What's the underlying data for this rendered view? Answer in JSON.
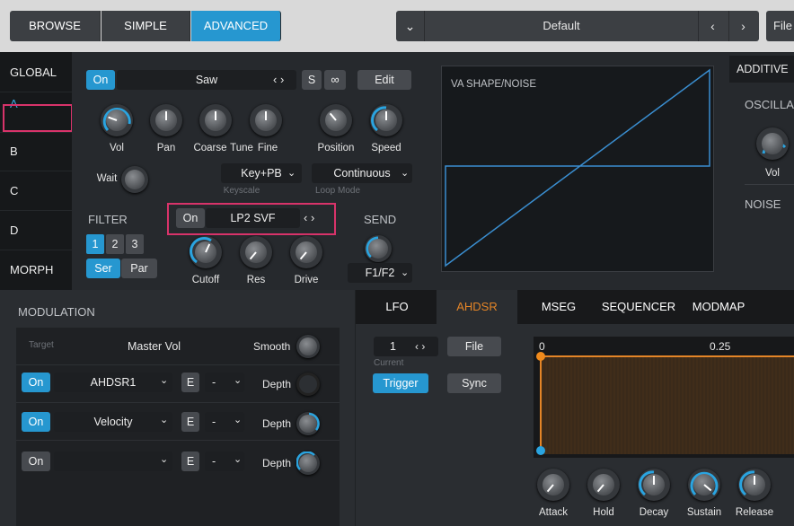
{
  "topbar": {
    "browse": "BROWSE",
    "simple": "SIMPLE",
    "advanced": "ADVANCED",
    "preset_name": "Default",
    "file": "File"
  },
  "left_tabs": [
    "GLOBAL",
    "A",
    "B",
    "C",
    "D",
    "MORPH"
  ],
  "osc": {
    "on": "On",
    "wave": "Saw",
    "s": "S",
    "edit": "Edit",
    "knobs": [
      "Vol",
      "Pan",
      "Coarse",
      "Tune",
      "Fine",
      "Position",
      "Speed"
    ],
    "wait": "Wait",
    "keyscale_value": "Key+PB",
    "keyscale_label": "Keyscale",
    "loop_value": "Continuous",
    "loop_label": "Loop Mode"
  },
  "filter": {
    "title": "FILTER",
    "on": "On",
    "type": "LP2 SVF",
    "nums": [
      "1",
      "2",
      "3"
    ],
    "ser": "Ser",
    "par": "Par",
    "knobs": [
      "Cutoff",
      "Res",
      "Drive"
    ]
  },
  "send": {
    "title": "SEND",
    "value": "F1/F2"
  },
  "graph": {
    "title": "VA SHAPE/NOISE"
  },
  "additive": {
    "tab": "ADDITIVE",
    "oscill": "OSCILLA",
    "vol": "Vol",
    "noise": "NOISE"
  },
  "modulation": {
    "title": "MODULATION",
    "target_label": "Target",
    "target": "Master Vol",
    "smooth": "Smooth",
    "rows": [
      {
        "on": "On",
        "source": "AHDSR1",
        "e": "E",
        "dash": "-",
        "depth": "Depth"
      },
      {
        "on": "On",
        "source": "Velocity",
        "e": "E",
        "dash": "-",
        "depth": "Depth"
      },
      {
        "on": "On",
        "source": "",
        "e": "E",
        "dash": "-",
        "depth": "Depth"
      }
    ]
  },
  "lfo_tabs": [
    "LFO",
    "AHDSR",
    "MSEG",
    "SEQUENCER",
    "MODMAP"
  ],
  "ahdsr": {
    "num": "1",
    "current": "Current",
    "file": "File",
    "trigger": "Trigger",
    "sync": "Sync",
    "ruler0": "0",
    "ruler1": "0.25",
    "knobs": [
      "Attack",
      "Hold",
      "Decay",
      "Sustain",
      "Release"
    ]
  },
  "colors": {
    "accent": "#2697d0",
    "orange": "#e48527",
    "highlight": "#d8336a"
  }
}
